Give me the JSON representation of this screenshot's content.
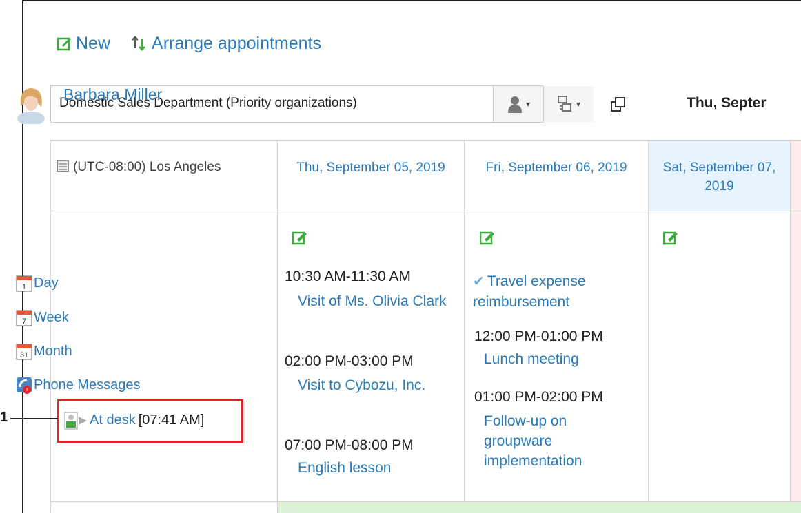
{
  "toolbar": {
    "new_label": "New",
    "arrange_label": "Arrange appointments"
  },
  "selector": {
    "value": "Domestic Sales Department (Priority organizations)"
  },
  "date_title": "Thu, Septer",
  "header": {
    "timezone": "(UTC-08:00) Los Angeles",
    "days": [
      {
        "label": "Thu, September 05, 2019"
      },
      {
        "label": "Fri, September 06, 2019"
      },
      {
        "label": "Sat, September 07, 2019"
      }
    ]
  },
  "user": {
    "name": "Barbara Miller",
    "links": {
      "day": "Day",
      "week": "Week",
      "month": "Month",
      "phone": "Phone Messages"
    },
    "cal_numbers": {
      "day": "1",
      "week": "7",
      "month": "31"
    },
    "presence": {
      "status": "At desk",
      "time": "[07:41 AM]"
    }
  },
  "callout": {
    "number": "1"
  },
  "schedule": {
    "thu": [
      {
        "time": "10:30 AM-11:30 AM",
        "title": "Visit of Ms. Olivia Clark"
      },
      {
        "time": "02:00 PM-03:00 PM",
        "title": "Visit to Cybozu, Inc."
      },
      {
        "time": "07:00 PM-08:00 PM",
        "title": "English lesson"
      }
    ],
    "fri": {
      "todo": "Travel expense reimbursement",
      "items": [
        {
          "time": "12:00 PM-01:00 PM",
          "title": "Lunch meeting"
        },
        {
          "time": "01:00 PM-02:00 PM",
          "title": "Follow-up on groupware implementation"
        }
      ]
    }
  },
  "colors": {
    "link": "#2a7ab8",
    "sat_bg": "#e8f4fd",
    "sun_bg": "#fdecec",
    "highlight": "#e2232a",
    "add_icon": "#3bab3b"
  }
}
